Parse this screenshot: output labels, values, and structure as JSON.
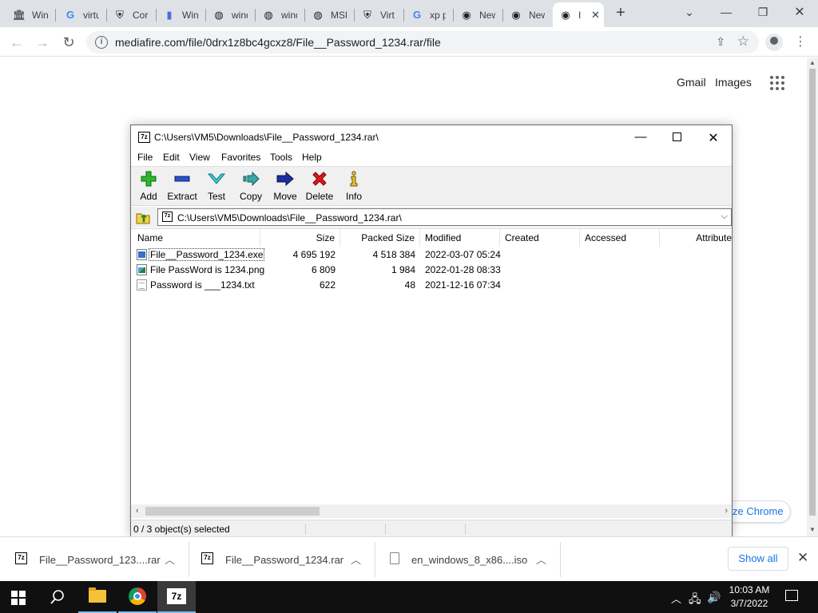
{
  "browser": {
    "tabs": [
      {
        "label": "Win",
        "icon": "library-icon"
      },
      {
        "label": "virtu",
        "icon": "google-icon"
      },
      {
        "label": "Cor",
        "icon": "vmware-icon"
      },
      {
        "label": "Win",
        "icon": "bookmark-icon"
      },
      {
        "label": "wind",
        "icon": "globe-icon"
      },
      {
        "label": "wind",
        "icon": "globe-icon"
      },
      {
        "label": "MSE",
        "icon": "globe-icon"
      },
      {
        "label": "Virt",
        "icon": "vmware-icon"
      },
      {
        "label": "xp p",
        "icon": "google-icon"
      },
      {
        "label": "New",
        "icon": "chrome-icon"
      },
      {
        "label": "New",
        "icon": "chrome-icon"
      },
      {
        "label": "I",
        "icon": "chrome-icon",
        "active": true
      }
    ],
    "url": "mediafire.com/file/0drx1z8bc4gcxz8/File__Password_1234.rar/file"
  },
  "page": {
    "gmail": "Gmail",
    "images": "Images",
    "chrome_pill": "ze Chrome"
  },
  "zip": {
    "title": "C:\\Users\\VM5\\Downloads\\File__Password_1234.rar\\",
    "menu": [
      "File",
      "Edit",
      "View",
      "Favorites",
      "Tools",
      "Help"
    ],
    "toolbar": [
      "Add",
      "Extract",
      "Test",
      "Copy",
      "Move",
      "Delete",
      "Info"
    ],
    "path": "C:\\Users\\VM5\\Downloads\\File__Password_1234.rar\\",
    "columns": [
      "Name",
      "Size",
      "Packed Size",
      "Modified",
      "Created",
      "Accessed",
      "Attribute"
    ],
    "files": [
      {
        "name": "File__Password_1234.exe",
        "size": "4 695 192",
        "packed": "4 518 384",
        "modified": "2022-03-07 05:24",
        "type": "exe"
      },
      {
        "name": "File PassWord is 1234.png",
        "size": "6 809",
        "packed": "1 984",
        "modified": "2022-01-28 08:33",
        "type": "png"
      },
      {
        "name": "Password is ___1234.txt",
        "size": "622",
        "packed": "48",
        "modified": "2021-12-16 07:34",
        "type": "txt"
      }
    ],
    "status": "0 / 3 object(s) selected"
  },
  "downloads": {
    "items": [
      {
        "name": "File__Password_123....rar"
      },
      {
        "name": "File__Password_1234.rar"
      },
      {
        "name": "en_windows_8_x86....iso"
      }
    ],
    "show_all": "Show all"
  },
  "taskbar": {
    "time": "10:03 AM",
    "date": "3/7/2022"
  }
}
